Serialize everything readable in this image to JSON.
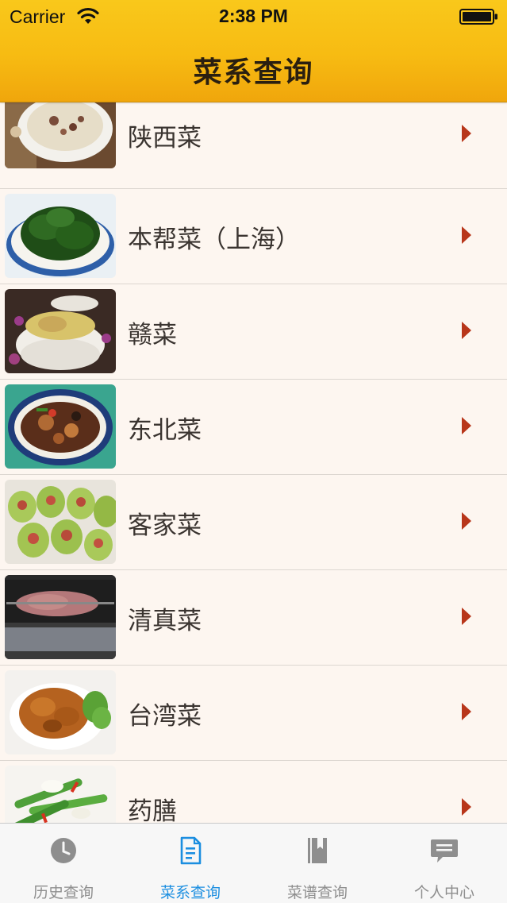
{
  "status_bar": {
    "carrier": "Carrier",
    "time": "2:38 PM"
  },
  "nav": {
    "title": "菜系查询"
  },
  "list": {
    "items": [
      {
        "label": "陕西菜"
      },
      {
        "label": "本帮菜（上海）"
      },
      {
        "label": "赣菜"
      },
      {
        "label": "东北菜"
      },
      {
        "label": "客家菜"
      },
      {
        "label": "清真菜"
      },
      {
        "label": "台湾菜"
      },
      {
        "label": "药膳"
      }
    ],
    "chevron_color": "#b8361a"
  },
  "tabbar": {
    "active_color": "#1b8ee0",
    "inactive_color": "#8e8e8e",
    "tabs": [
      {
        "label": "历史查询",
        "icon": "clock-icon"
      },
      {
        "label": "菜系查询",
        "icon": "document-icon"
      },
      {
        "label": "菜谱查询",
        "icon": "book-icon"
      },
      {
        "label": "个人中心",
        "icon": "chat-bubble-icon"
      }
    ]
  }
}
